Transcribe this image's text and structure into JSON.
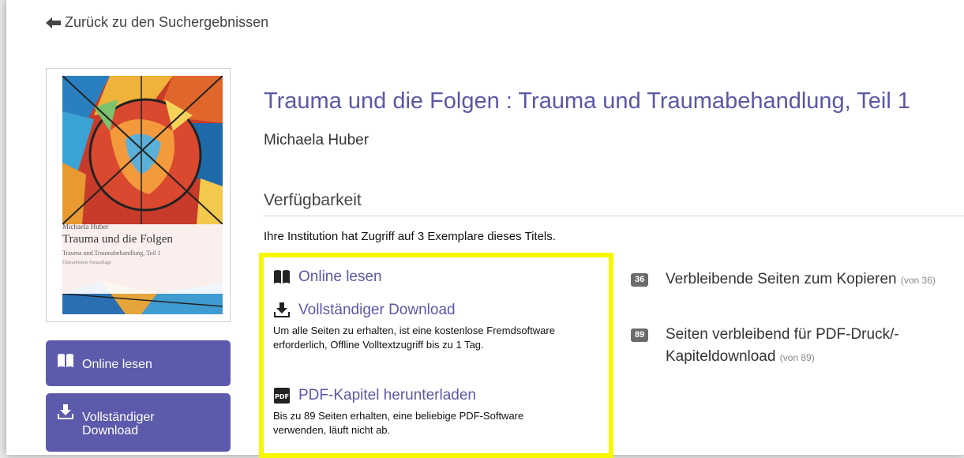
{
  "nav": {
    "back_label": "Zurück zu den Suchergebnissen"
  },
  "cover": {
    "author": "Michaela Huber",
    "title": "Trauma und die Folgen",
    "subtitle": "Trauma und Traumabehandlung, Teil 1",
    "edition": "Überarbeitete Neuauflage"
  },
  "sidebar": {
    "online_button": "Online lesen",
    "download_button": "Vollständiger Download"
  },
  "book": {
    "title": "Trauma und die Folgen : Trauma und Traumabehandlung, Teil 1",
    "author": "Michaela Huber"
  },
  "availability": {
    "heading": "Verfügbarkeit",
    "access_info": "Ihre Institution hat Zugriff auf 3 Exemplare dieses Titels.",
    "options": {
      "online": {
        "label": "Online lesen"
      },
      "download": {
        "label": "Vollständiger Download",
        "description": "Um alle Seiten zu erhalten, ist eine kostenlose Fremdsoftware erforderlich, Offline Volltextzugriff bis zu 1 Tag."
      },
      "pdf": {
        "label": "PDF-Kapitel herunterladen",
        "description": "Bis zu 89 Seiten erhalten, eine beliebige PDF-Software verwenden, läuft nicht ab."
      }
    },
    "stats": {
      "copy": {
        "badge": "36",
        "text": "Verbleibende Seiten zum Kopieren",
        "of": "(von 36)"
      },
      "pdf": {
        "badge": "89",
        "text": "Seiten verbleibend für PDF-Druck/-Kapiteldownload",
        "of": "(von 89)"
      }
    }
  },
  "colors": {
    "accent": "#5a58a6",
    "button": "#5c5aab",
    "highlight": "#f7f700",
    "badge": "#6b6b6b"
  }
}
